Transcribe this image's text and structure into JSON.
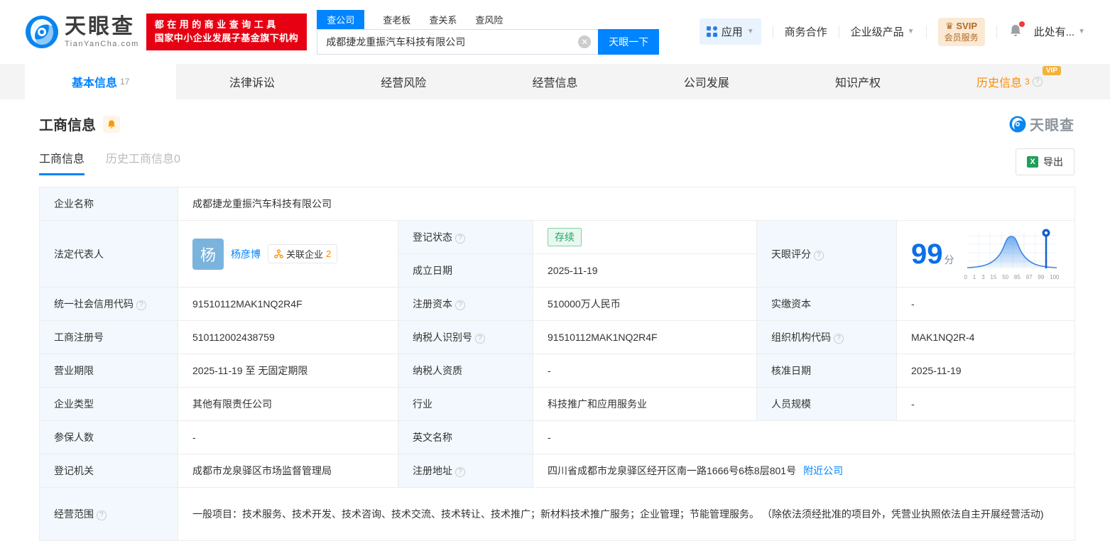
{
  "brand": {
    "logo_text": "天眼查",
    "logo_domain": "TianYanCha.com",
    "slogan_line1": "都在用的商业查询工具",
    "slogan_line2": "国家中小企业发展子基金旗下机构"
  },
  "header": {
    "search": {
      "tabs": [
        "查公司",
        "查老板",
        "查关系",
        "查风险"
      ],
      "value": "成都捷龙重振汽车科技有限公司",
      "button_label": "天眼一下"
    },
    "nav": {
      "app": "应用",
      "cooperation": "商务合作",
      "enterprise": "企业级产品",
      "svip_line1": "SVIP",
      "svip_line2": "会员服务",
      "user_menu": "此处有..."
    }
  },
  "tabs": {
    "items": [
      {
        "label": "基本信息",
        "count": "17"
      },
      {
        "label": "法律诉讼"
      },
      {
        "label": "经营风险"
      },
      {
        "label": "经营信息"
      },
      {
        "label": "公司发展"
      },
      {
        "label": "知识产权"
      },
      {
        "label": "历史信息",
        "count": "3",
        "badge": "VIP"
      }
    ]
  },
  "section": {
    "title": "工商信息",
    "subtab_active": "工商信息",
    "subtab_history": "历史工商信息0",
    "export_label": "导出",
    "watermark": "天眼查"
  },
  "fields": {
    "company_name": {
      "label": "企业名称",
      "value": "成都捷龙重振汽车科技有限公司"
    },
    "legal_rep": {
      "label": "法定代表人",
      "avatar": "杨",
      "name": "杨彦博",
      "related_label": "关联企业",
      "related_count": "2"
    },
    "reg_status": {
      "label": "登记状态",
      "value": "存续"
    },
    "establish_date": {
      "label": "成立日期",
      "value": "2025-11-19"
    },
    "score": {
      "label": "天眼评分",
      "value": "99",
      "unit": "分"
    },
    "usci": {
      "label": "统一社会信用代码",
      "value": "91510112MAK1NQ2R4F"
    },
    "reg_capital": {
      "label": "注册资本",
      "value": "510000万人民币"
    },
    "paid_capital": {
      "label": "实缴资本",
      "value": "-"
    },
    "reg_number": {
      "label": "工商注册号",
      "value": "510112002438759"
    },
    "taxpayer_id": {
      "label": "纳税人识别号",
      "value": "91510112MAK1NQ2R4F"
    },
    "org_code": {
      "label": "组织机构代码",
      "value": "MAK1NQ2R-4"
    },
    "business_term": {
      "label": "营业期限",
      "value": "2025-11-19 至 无固定期限"
    },
    "taxpayer_quality": {
      "label": "纳税人资质",
      "value": "-"
    },
    "approval_date": {
      "label": "核准日期",
      "value": "2025-11-19"
    },
    "company_type": {
      "label": "企业类型",
      "value": "其他有限责任公司"
    },
    "industry": {
      "label": "行业",
      "value": "科技推广和应用服务业"
    },
    "staff_size": {
      "label": "人员规模",
      "value": "-"
    },
    "insured_count": {
      "label": "参保人数",
      "value": "-"
    },
    "english_name": {
      "label": "英文名称",
      "value": "-"
    },
    "reg_authority": {
      "label": "登记机关",
      "value": "成都市龙泉驿区市场监督管理局"
    },
    "reg_address": {
      "label": "注册地址",
      "value": "四川省成都市龙泉驿区经开区南一路1666号6栋8层801号",
      "link": "附近公司"
    },
    "business_scope": {
      "label": "经营范围",
      "value": "一般项目：技术服务、技术开发、技术咨询、技术交流、技术转让、技术推广；新材料技术推广服务；企业管理；节能管理服务。 （除依法须经批准的项目外，凭营业执照依法自主开展经营活动)"
    }
  },
  "chart_data": {
    "type": "area",
    "title": "天眼评分分布曲线",
    "x_tick_labels": [
      "0",
      "1",
      "3",
      "15",
      "50",
      "85",
      "97",
      "99",
      "100"
    ],
    "curve_shape": "normal-distribution",
    "marker_value": 99,
    "score": 99,
    "legend": "none",
    "grid": true
  },
  "colors": {
    "brand_blue": "#0084ff",
    "banner_red": "#e60012",
    "accent_orange": "#ff8a00",
    "status_green": "#1fa567"
  }
}
